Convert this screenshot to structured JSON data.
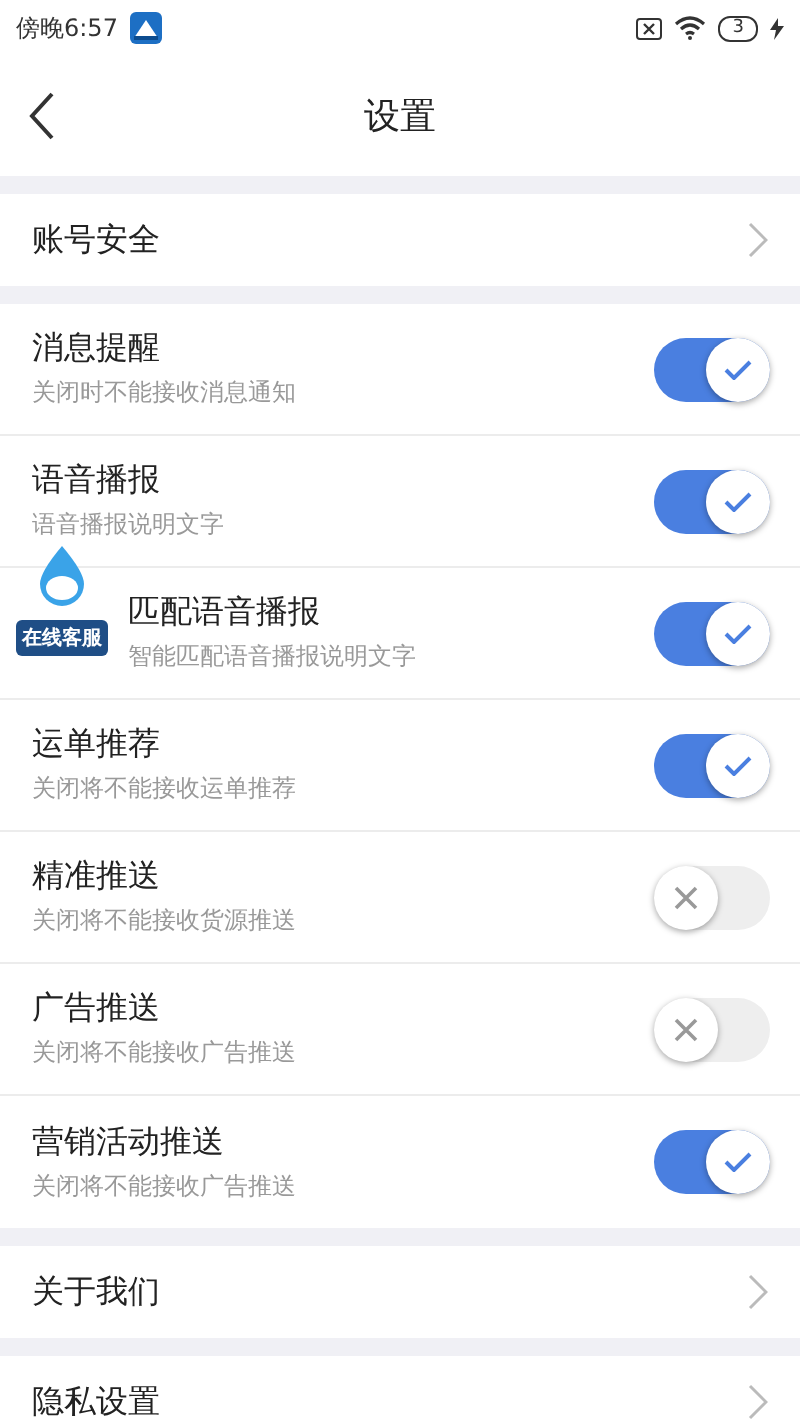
{
  "status_bar": {
    "time": "傍晚6:57",
    "battery": "3"
  },
  "header": {
    "title": "设置"
  },
  "sections": [
    {
      "items": [
        {
          "kind": "link",
          "title": "账号安全"
        }
      ]
    },
    {
      "items": [
        {
          "kind": "toggle",
          "title": "消息提醒",
          "subtitle": "关闭时不能接收消息通知",
          "on": true
        },
        {
          "kind": "toggle",
          "title": "语音播报",
          "subtitle": "语音播报说明文字",
          "on": true
        },
        {
          "kind": "toggle",
          "title": "匹配语音播报",
          "subtitle": "智能匹配语音播报说明文字",
          "on": true,
          "badge": "在线客服"
        },
        {
          "kind": "toggle",
          "title": "运单推荐",
          "subtitle": "关闭将不能接收运单推荐",
          "on": true
        },
        {
          "kind": "toggle",
          "title": "精准推送",
          "subtitle": "关闭将不能接收货源推送",
          "on": false
        },
        {
          "kind": "toggle",
          "title": "广告推送",
          "subtitle": "关闭将不能接收广告推送",
          "on": false
        },
        {
          "kind": "toggle",
          "title": "营销活动推送",
          "subtitle": "关闭将不能接收广告推送",
          "on": true
        }
      ]
    },
    {
      "items": [
        {
          "kind": "link",
          "title": "关于我们"
        }
      ]
    },
    {
      "items": [
        {
          "kind": "link",
          "title": "隐私设置"
        }
      ]
    }
  ]
}
